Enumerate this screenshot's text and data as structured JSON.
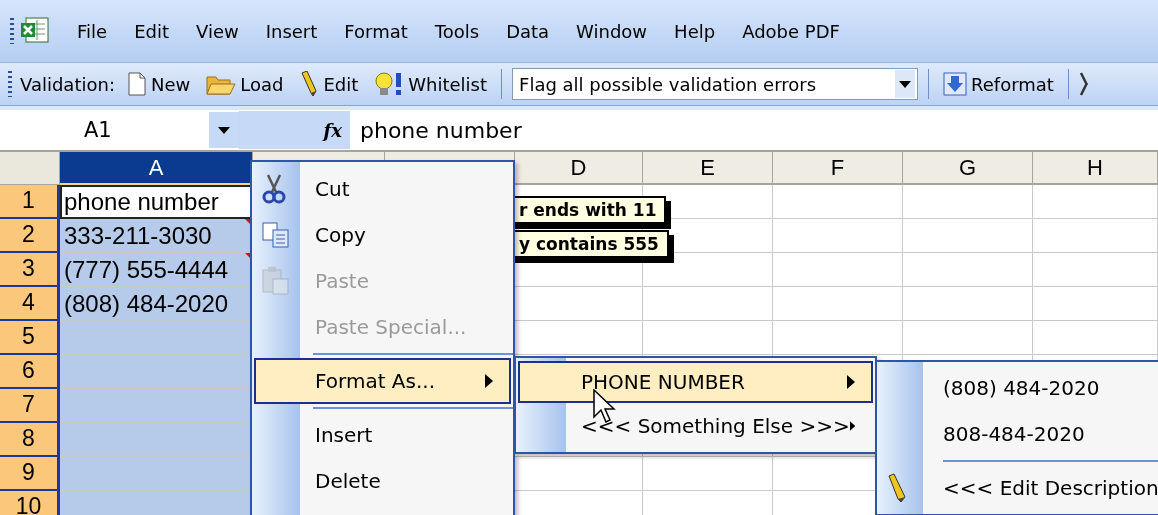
{
  "menu_bar": {
    "items": [
      "File",
      "Edit",
      "View",
      "Insert",
      "Format",
      "Tools",
      "Data",
      "Window",
      "Help",
      "Adobe PDF"
    ]
  },
  "toolbar": {
    "label": "Validation:",
    "buttons": [
      {
        "label": "New"
      },
      {
        "label": "Load"
      },
      {
        "label": "Edit"
      },
      {
        "label": "Whitelist"
      }
    ],
    "mode_select": {
      "value": "Flag all possible validation errors"
    },
    "reformat": {
      "label": "Reformat"
    }
  },
  "formula_bar": {
    "name_box": "A1",
    "function_label": "fx",
    "value": "phone number"
  },
  "sheet": {
    "columns": [
      {
        "label": "A",
        "selected": true
      },
      {
        "selected": false
      },
      {
        "selected": false
      },
      {
        "label": "D",
        "selected": false
      },
      {
        "label": "E",
        "selected": false
      },
      {
        "label": "F",
        "selected": false
      },
      {
        "label": "G",
        "selected": false
      },
      {
        "label": "H",
        "selected": false
      }
    ],
    "rows": [
      {
        "number": "1",
        "selected": true,
        "active": true,
        "comment": false,
        "value": "phone number"
      },
      {
        "number": "2",
        "selected": true,
        "active": false,
        "comment": true,
        "value": "333-211-3030"
      },
      {
        "number": "3",
        "selected": true,
        "active": false,
        "comment": true,
        "value": "(777) 555-4444"
      },
      {
        "number": "4",
        "selected": true,
        "active": false,
        "comment": false,
        "value": "(808) 484-2020"
      },
      {
        "number": "5",
        "selected": true,
        "active": false,
        "comment": false
      },
      {
        "number": "6",
        "selected": true,
        "active": false,
        "comment": false
      },
      {
        "number": "7",
        "selected": true,
        "active": false,
        "comment": false
      },
      {
        "number": "8",
        "selected": true,
        "active": false,
        "comment": false
      },
      {
        "number": "9",
        "selected": true,
        "active": false,
        "comment": false
      },
      {
        "number": "10",
        "selected": true,
        "active": false,
        "comment": false
      }
    ]
  },
  "comments": [
    {
      "text": "r ends with 11"
    },
    {
      "text": "y contains 555"
    }
  ],
  "context_menu": {
    "items": [
      {
        "kind": "item",
        "label": "Cut",
        "disabled": false,
        "selected": false,
        "submenu": false
      },
      {
        "kind": "item",
        "label": "Copy",
        "disabled": false,
        "selected": false,
        "submenu": false
      },
      {
        "kind": "item",
        "label": "Paste",
        "disabled": true,
        "selected": false,
        "submenu": false
      },
      {
        "kind": "item",
        "label": "Paste Special...",
        "disabled": true,
        "selected": false,
        "submenu": false
      },
      {
        "kind": "separator"
      },
      {
        "kind": "item",
        "label": "Format As...",
        "disabled": false,
        "selected": true,
        "submenu": true
      },
      {
        "kind": "separator"
      },
      {
        "kind": "item",
        "label": "Insert",
        "disabled": false,
        "selected": false,
        "submenu": false
      },
      {
        "kind": "item",
        "label": "Delete",
        "disabled": false,
        "selected": false,
        "submenu": false
      }
    ]
  },
  "format_submenu": {
    "items": [
      {
        "label": "PHONE NUMBER",
        "selected": true,
        "submenu": true
      },
      {
        "label": "<<< Something Else >>>",
        "selected": false,
        "submenu": true
      }
    ]
  },
  "phone_submenu": {
    "items": [
      {
        "kind": "item",
        "label": "(808) 484-2020"
      },
      {
        "kind": "item",
        "label": "808-484-2020"
      },
      {
        "kind": "separator"
      },
      {
        "kind": "edit",
        "label": "<<< Edit Description"
      }
    ]
  }
}
